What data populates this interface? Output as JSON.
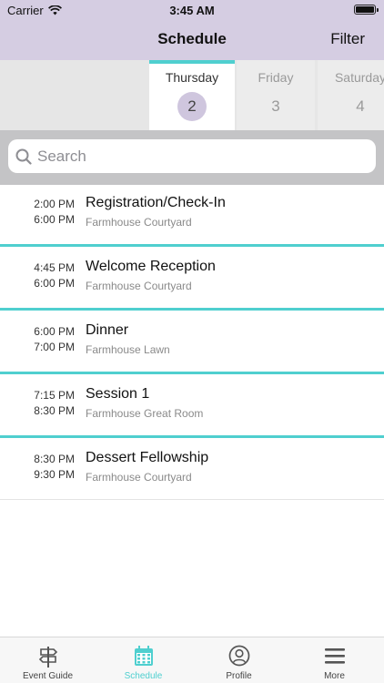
{
  "status_bar": {
    "carrier": "Carrier",
    "time": "3:45 AM"
  },
  "nav": {
    "title": "Schedule",
    "filter_label": "Filter"
  },
  "days": [
    {
      "name": "Thursday",
      "num": "2",
      "selected": true
    },
    {
      "name": "Friday",
      "num": "3",
      "selected": false
    },
    {
      "name": "Saturday",
      "num": "4",
      "selected": false
    }
  ],
  "search": {
    "placeholder": "Search",
    "value": ""
  },
  "sessions": [
    {
      "start": "2:00 PM",
      "end": "6:00 PM",
      "title": "Registration/Check-In",
      "location": "Farmhouse Courtyard"
    },
    {
      "start": "4:45 PM",
      "end": "6:00 PM",
      "title": "Welcome Reception",
      "location": "Farmhouse Courtyard"
    },
    {
      "start": "6:00 PM",
      "end": "7:00 PM",
      "title": "Dinner",
      "location": "Farmhouse Lawn"
    },
    {
      "start": "7:15 PM",
      "end": "8:30 PM",
      "title": "Session 1",
      "location": "Farmhouse Great Room"
    },
    {
      "start": "8:30 PM",
      "end": "9:30 PM",
      "title": "Dessert Fellowship",
      "location": "Farmhouse Courtyard"
    }
  ],
  "tabs": [
    {
      "label": "Event Guide",
      "icon": "signpost-icon",
      "active": false
    },
    {
      "label": "Schedule",
      "icon": "calendar-icon",
      "active": true
    },
    {
      "label": "Profile",
      "icon": "profile-icon",
      "active": false
    },
    {
      "label": "More",
      "icon": "menu-icon",
      "active": false
    }
  ],
  "colors": {
    "header": "#d5cde2",
    "accent": "#4fcfcf",
    "selected_day": "#cfc6de"
  }
}
